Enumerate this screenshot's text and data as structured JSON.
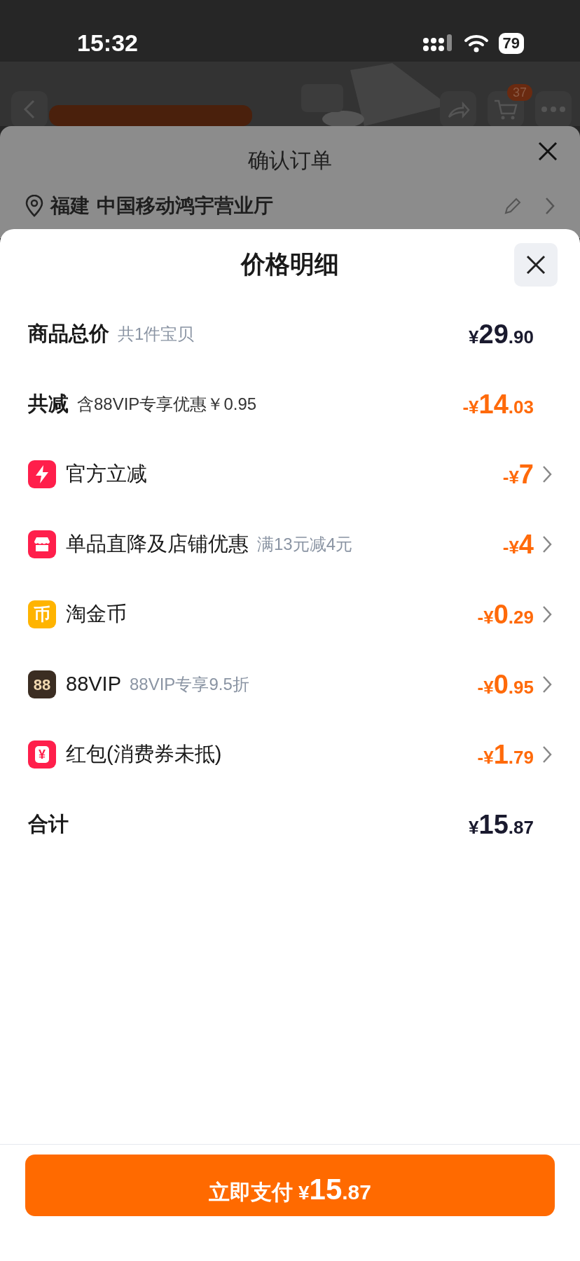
{
  "status_bar": {
    "time": "15:32",
    "battery": "79"
  },
  "background": {
    "cart_badge": "37",
    "sheet_title": "确认订单",
    "region": "福建",
    "address": "中国移动鸿宇营业厅"
  },
  "price_detail": {
    "title": "价格明细",
    "rows": [
      {
        "kind": "summary",
        "label": "商品总价",
        "note": "共1件宝贝",
        "currency": "¥",
        "whole": "29",
        "fraction": ".90"
      },
      {
        "kind": "saving",
        "label": "共减",
        "note": "含88VIP专享优惠￥0.95",
        "currency": "-¥",
        "whole": "14",
        "fraction": ".03"
      },
      {
        "kind": "discount",
        "label": "官方立减",
        "currency": "-¥",
        "whole": "7"
      },
      {
        "kind": "discount",
        "label": "单品直降及店铺优惠",
        "note": "满13元减4元",
        "currency": "-¥",
        "whole": "4"
      },
      {
        "kind": "discount",
        "label": "淘金币",
        "icon_glyph": "币",
        "currency": "-¥",
        "whole": "0",
        "fraction": ".29"
      },
      {
        "kind": "discount",
        "label": "88VIP",
        "icon_glyph": "88",
        "note": "88VIP专享9.5折",
        "currency": "-¥",
        "whole": "0",
        "fraction": ".95"
      },
      {
        "kind": "discount",
        "label": "红包(消费券未抵)",
        "icon_glyph": "¥",
        "currency": "-¥",
        "whole": "1",
        "fraction": ".79"
      },
      {
        "kind": "summary",
        "label": "合计",
        "currency": "¥",
        "whole": "15",
        "fraction": ".87"
      }
    ]
  },
  "pay_button": {
    "label": "立即支付",
    "currency": "¥",
    "whole": "15",
    "fraction": ".87"
  }
}
